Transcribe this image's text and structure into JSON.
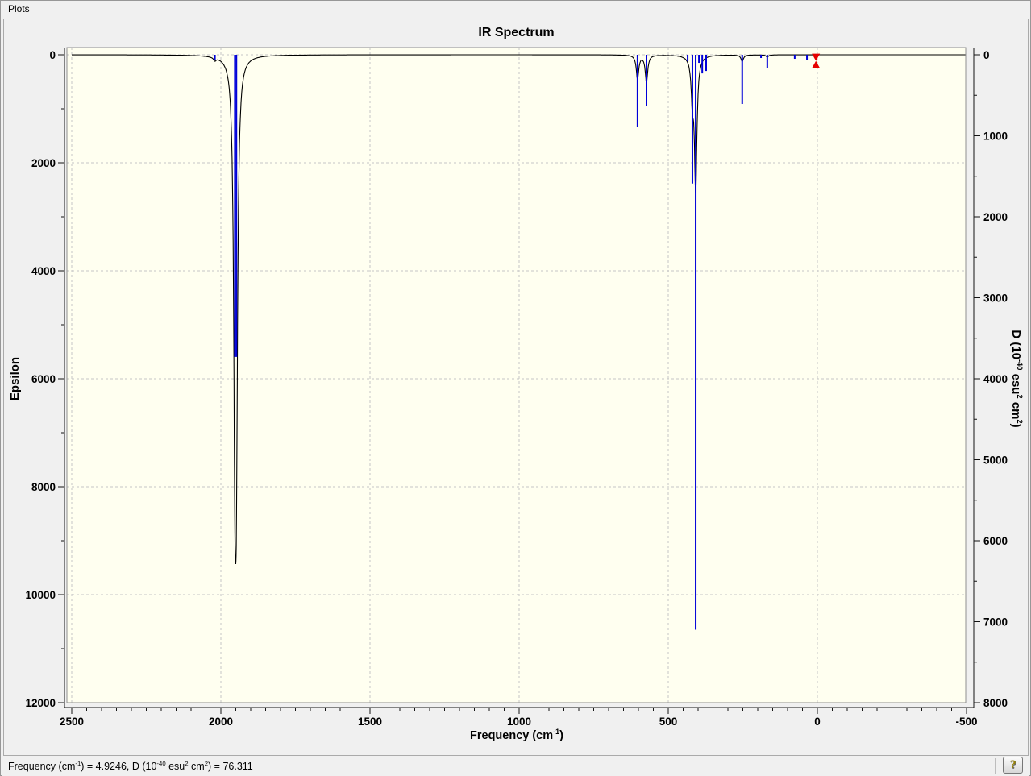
{
  "window": {
    "title": "Plots"
  },
  "help_button": {
    "label": "?"
  },
  "status_bar": {
    "parts": [
      [
        "text",
        "Frequency (cm"
      ],
      [
        "sup",
        "-1"
      ],
      [
        "text",
        ") = 4.9246, D (10"
      ],
      [
        "sup",
        "-40"
      ],
      [
        "text",
        " esu"
      ],
      [
        "sup",
        "2"
      ],
      [
        "text",
        " cm"
      ],
      [
        "sup",
        "2"
      ],
      [
        "text",
        ") = 76.311"
      ]
    ]
  },
  "chart_data": {
    "type": "line",
    "title": "IR Spectrum",
    "x_axis": {
      "title_parts": [
        [
          "text",
          "Frequency (cm"
        ],
        [
          "sup",
          "-1"
        ],
        [
          "text",
          ")"
        ]
      ],
      "min": -500,
      "max": 2500,
      "reversed": true,
      "major_step": 500,
      "minor_step": 50,
      "major_ticks": [
        2500,
        2000,
        1500,
        1000,
        500,
        0,
        -500
      ]
    },
    "y_left": {
      "title": "Epsilon",
      "min": 0,
      "max": 12000,
      "downward": true,
      "major_step": 2000,
      "minor_step": 1000,
      "major_ticks": [
        0,
        2000,
        4000,
        6000,
        8000,
        10000,
        12000
      ]
    },
    "y_right": {
      "title_parts": [
        [
          "text",
          "D (10"
        ],
        [
          "sup",
          "-40"
        ],
        [
          "text",
          " esu"
        ],
        [
          "sup",
          "2"
        ],
        [
          "text",
          " cm"
        ],
        [
          "sup",
          "2"
        ],
        [
          "text",
          ")"
        ]
      ],
      "min": 0,
      "max": 8000,
      "downward": true,
      "major_step": 1000,
      "minor_step": 500,
      "major_ticks": [
        0,
        1000,
        2000,
        3000,
        4000,
        5000,
        6000,
        7000,
        8000
      ]
    },
    "grid": {
      "show": true,
      "style": "dashed"
    },
    "legend": {
      "show": false
    },
    "curve": {
      "name": "epsilon-curve",
      "model": "lorentzian_sum",
      "hwhm": 5,
      "color": "#000000"
    },
    "stems": {
      "name": "dipole-strength-stems",
      "color": "#0000d8",
      "axis": "y_right"
    },
    "modes": [
      {
        "freq": 2020,
        "epsilon": 60,
        "d": 60
      },
      {
        "freq": 1953,
        "epsilon": 5900,
        "d": 3730
      },
      {
        "freq": 1948,
        "epsilon": 5900,
        "d": 3730
      },
      {
        "freq": 603,
        "epsilon": 440,
        "d": 895
      },
      {
        "freq": 573,
        "epsilon": 500,
        "d": 627
      },
      {
        "freq": 435,
        "epsilon": 0,
        "d": 80
      },
      {
        "freq": 419,
        "epsilon": 700,
        "d": 1590
      },
      {
        "freq": 408,
        "epsilon": 2450,
        "d": 7100
      },
      {
        "freq": 397,
        "epsilon": 0,
        "d": 100
      },
      {
        "freq": 386,
        "epsilon": 0,
        "d": 230
      },
      {
        "freq": 373,
        "epsilon": 0,
        "d": 200
      },
      {
        "freq": 252,
        "epsilon": 120,
        "d": 607
      },
      {
        "freq": 189,
        "epsilon": 0,
        "d": 40
      },
      {
        "freq": 168,
        "epsilon": 40,
        "d": 160
      },
      {
        "freq": 76,
        "epsilon": 0,
        "d": 50
      },
      {
        "freq": 35,
        "epsilon": 0,
        "d": 60
      }
    ],
    "marker": {
      "freq": 4.9246,
      "d": 76.311,
      "color": "#e60000"
    },
    "colors": {
      "plot_background": "#fffff0",
      "outer_background": "#f0f0f0",
      "grid": "#c6c6c6",
      "frame": "#8f8f8f",
      "axis": "#141414",
      "curve": "#000000",
      "stem": "#0000d8",
      "marker": "#e60000"
    }
  }
}
